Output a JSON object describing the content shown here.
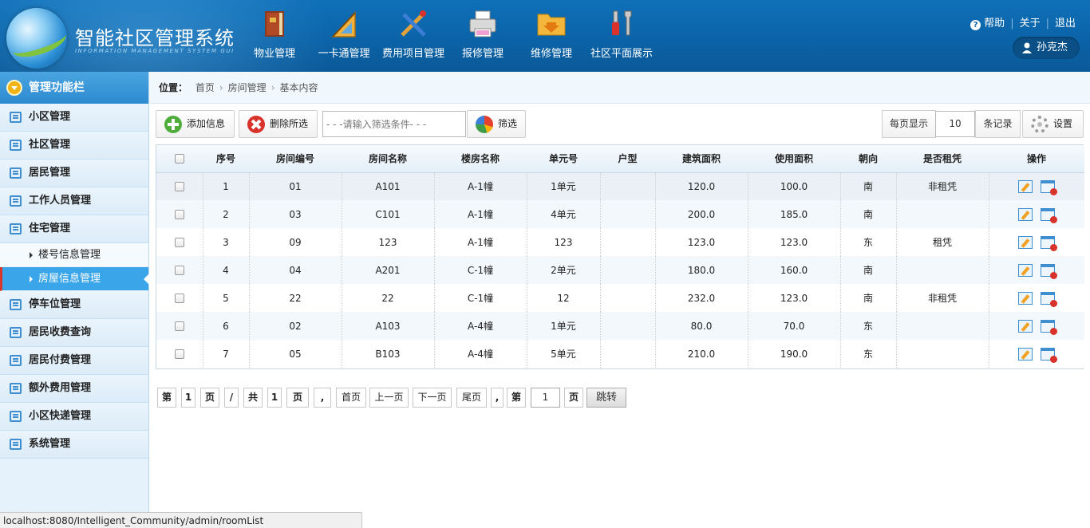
{
  "header": {
    "app_title": "智能社区管理系统",
    "app_subtitle": "INFORMATION MANAGEMENT SYSTEM GUI",
    "nav": [
      {
        "label": "物业管理",
        "icon": "book-icon"
      },
      {
        "label": "一卡通管理",
        "icon": "ruler-icon"
      },
      {
        "label": "费用项目管理",
        "icon": "tools-icon"
      },
      {
        "label": "报修管理",
        "icon": "printer-icon"
      },
      {
        "label": "维修管理",
        "icon": "folder-download-icon"
      },
      {
        "label": "社区平面展示",
        "icon": "wrench-screwdriver-icon"
      }
    ],
    "links": {
      "help": "帮助",
      "about": "关于",
      "logout": "退出"
    },
    "user_name": "孙克杰"
  },
  "sidebar": {
    "title": "管理功能栏",
    "items": [
      {
        "label": "小区管理"
      },
      {
        "label": "社区管理"
      },
      {
        "label": "居民管理"
      },
      {
        "label": "工作人员管理"
      },
      {
        "label": "住宅管理"
      }
    ],
    "sub_items": [
      {
        "label": "楼号信息管理"
      },
      {
        "label": "房屋信息管理"
      }
    ],
    "items_after": [
      {
        "label": "停车位管理"
      },
      {
        "label": "居民收费查询"
      },
      {
        "label": "居民付费管理"
      },
      {
        "label": "额外费用管理"
      },
      {
        "label": "小区快递管理"
      },
      {
        "label": "系统管理"
      }
    ]
  },
  "breadcrumb": {
    "prefix": "位置：",
    "items": [
      "首页",
      "房间管理",
      "基本内容"
    ]
  },
  "toolbar": {
    "add_label": "添加信息",
    "delete_label": "删除所选",
    "filter_placeholder": "- - -请输入筛选条件- - -",
    "filter_label": "筛选",
    "per_page_label": "每页显示",
    "per_page_value": "10",
    "records_label": "条记录",
    "settings_label": "设置"
  },
  "table": {
    "headers": [
      "序号",
      "房间编号",
      "房间名称",
      "楼房名称",
      "单元号",
      "户型",
      "建筑面积",
      "使用面积",
      "朝向",
      "是否租凭",
      "操作"
    ],
    "rows": [
      [
        "1",
        "01",
        "A101",
        "A-1幢",
        "1单元",
        "",
        "120.0",
        "100.0",
        "南",
        "非租凭"
      ],
      [
        "2",
        "03",
        "C101",
        "A-1幢",
        "4单元",
        "",
        "200.0",
        "185.0",
        "南",
        ""
      ],
      [
        "3",
        "09",
        "123",
        "A-1幢",
        "123",
        "",
        "123.0",
        "123.0",
        "东",
        "租凭"
      ],
      [
        "4",
        "04",
        "A201",
        "C-1幢",
        "2单元",
        "",
        "180.0",
        "160.0",
        "南",
        ""
      ],
      [
        "5",
        "22",
        "22",
        "C-1幢",
        "12",
        "",
        "232.0",
        "123.0",
        "南",
        "非租凭"
      ],
      [
        "6",
        "02",
        "A103",
        "A-4幢",
        "1单元",
        "",
        "80.0",
        "70.0",
        "东",
        ""
      ],
      [
        "7",
        "05",
        "B103",
        "A-4幢",
        "5单元",
        "",
        "210.0",
        "190.0",
        "东",
        ""
      ]
    ]
  },
  "pager": {
    "di": "第",
    "current": "1",
    "ye": "页",
    "slash": "/",
    "gong": "共",
    "total": "1",
    "ye2": "页",
    "comma": ",",
    "first": "首页",
    "prev": "上一页",
    "next": "下一页",
    "last": "尾页",
    "comma2": ",",
    "di2": "第",
    "jump_value": "1",
    "ye3": "页",
    "go": "跳转"
  },
  "status_bar": "localhost:8080/Intelligent_Community/admin/roomList"
}
